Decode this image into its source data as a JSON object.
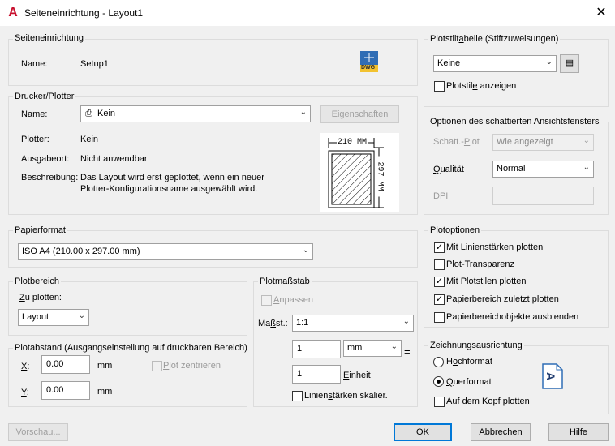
{
  "window": {
    "title": "Seiteneinrichtung - Layout1",
    "close": "✕",
    "app_icon": "autocad-icon"
  },
  "page_setup": {
    "legend": "Seiteneinrichtung",
    "name_label": "Name:",
    "name_value": "Setup1",
    "dwg_icon_text": "DWG"
  },
  "printer": {
    "legend": "Drucker/Plotter",
    "name_label": "Name:",
    "name_value": "Kein",
    "properties_button": "Eigenschaften",
    "plotter_label": "Plotter:",
    "plotter_value": "Kein",
    "location_label": "Ausgabeort:",
    "location_value": "Nicht anwendbar",
    "description_label": "Beschreibung:",
    "description_line1": "Das Layout wird erst geplottet, wenn ein neuer",
    "description_line2": "Plotter-Konfigurationsname ausgewählt wird.",
    "preview_width": "210 MM",
    "preview_height": "297 MM"
  },
  "paper_size": {
    "legend": "Papierformat",
    "value": "ISO A4 (210.00 x 297.00 mm)"
  },
  "plot_area": {
    "legend": "Plotbereich",
    "what_label": "Zu plotten:",
    "what_value": "Layout"
  },
  "plot_offset": {
    "legend": "Plotabstand (Ausgangseinstellung auf druckbaren Bereich)",
    "x_label": "X:",
    "x_value": "0.00",
    "x_unit": "mm",
    "y_label": "Y:",
    "y_value": "0.00",
    "y_unit": "mm",
    "center_label": "Plot zentrieren"
  },
  "plot_scale": {
    "legend": "Plotmaßstab",
    "fit_label": "Anpassen",
    "scale_label": "Maßst.:",
    "scale_value": "1:1",
    "value1": "1",
    "unit_value": "mm",
    "equals": "=",
    "value2": "1",
    "unit_label": "Einheit",
    "lineweights_label": "Linienstärken skalier."
  },
  "plot_style_table": {
    "legend": "Plotstiltabelle (Stiftzuweisungen)",
    "value": "Keine",
    "show_label": "Plotstile anzeigen"
  },
  "shaded_viewport": {
    "legend": "Optionen des schattierten Ansichtsfensters",
    "shade_label": "Schatt.-Plot",
    "shade_value": "Wie angezeigt",
    "quality_label": "Qualität",
    "quality_value": "Normal",
    "dpi_label": "DPI"
  },
  "plot_options": {
    "legend": "Plotoptionen",
    "items": [
      {
        "label": "Mit Linienstärken plotten",
        "checked": true
      },
      {
        "label": "Plot-Transparenz",
        "checked": false
      },
      {
        "label": "Mit Plotstilen plotten",
        "checked": true
      },
      {
        "label": "Papierbereich zuletzt plotten",
        "checked": true
      },
      {
        "label": "Papierbereichobjekte ausblenden",
        "checked": false
      }
    ]
  },
  "orientation": {
    "legend": "Zeichnungsausrichtung",
    "portrait": "Hochformat",
    "landscape": "Querformat",
    "upside_down": "Auf dem Kopf plotten",
    "icon_letter": "A"
  },
  "footer": {
    "preview": "Vorschau...",
    "ok": "OK",
    "cancel": "Abbrechen",
    "help": "Hilfe"
  }
}
